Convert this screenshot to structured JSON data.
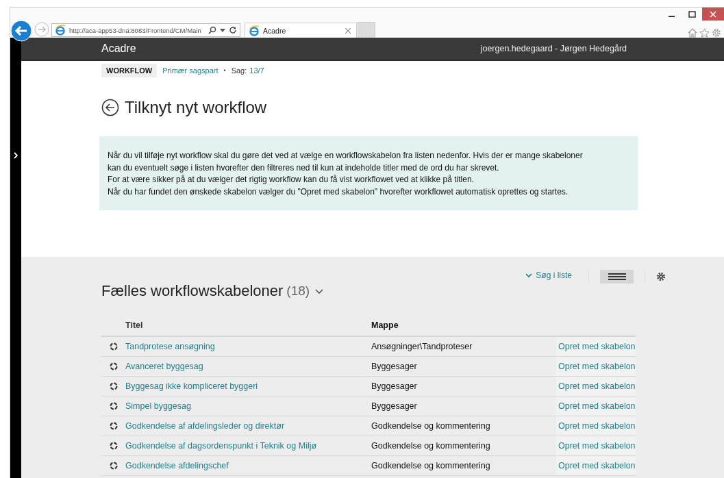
{
  "browser": {
    "url": "http://aca-app53-dna:8083/Frontend/CM/Main",
    "tab_title": "Acadre"
  },
  "header": {
    "brand": "Acadre",
    "user": "joergen.hedegaard - Jørgen Hedegård"
  },
  "breadcrumb": {
    "tag": "WORKFLOW",
    "link": "Primær sagspart",
    "separator": "•",
    "case_label": "Sag:",
    "case_value": "13/7"
  },
  "page_title": "Tilknyt nyt workflow",
  "info": [
    "Når du vil tilføje nyt workflow skal du gøre det ved at vælge en workflowskabelon fra listen nedenfor. Hvis der er mange skabeloner kan du eventuelt søge i listen hvorefter den filtreres ned til kun at indeholde titler med de ord du har skrevet.",
    "For at være sikker på at du vælger det rigtig workflow kan du få vist workflowet ved at klikke på titlen.",
    "Når du har fundet den ønskede skabelon vælger du \"Opret med skabelon\" hvorefter workflowet automatisk oprettes og startes."
  ],
  "list": {
    "title": "Fælles workflowskabeloner",
    "count": "(18)",
    "search": "Søg i liste",
    "columns": [
      "Titel",
      "Mappe"
    ],
    "rows": [
      {
        "title": "Tandprotese ansøgning",
        "folder": "Ansøgninger\\Tandproteser",
        "action": "Opret med skabelon"
      },
      {
        "title": "Avanceret byggesag",
        "folder": "Byggesager",
        "action": "Opret med skabelon"
      },
      {
        "title": "Byggesag ikke kompliceret byggeri",
        "folder": "Byggesager",
        "action": "Opret med skabelon"
      },
      {
        "title": "Simpel byggesag",
        "folder": "Byggesager",
        "action": "Opret med skabelon"
      },
      {
        "title": "Godkendelse af afdelingsleder og direktør",
        "folder": "Godkendelse og kommentering",
        "action": "Opret med skabelon"
      },
      {
        "title": "Godkendelse af dagsordenspunkt i Teknik og Miljø",
        "folder": "Godkendelse og kommentering",
        "action": "Opret med skabelon"
      },
      {
        "title": "Godkendelse afdelingschef",
        "folder": "Godkendelse og kommentering",
        "action": "Opret med skabelon"
      }
    ]
  }
}
